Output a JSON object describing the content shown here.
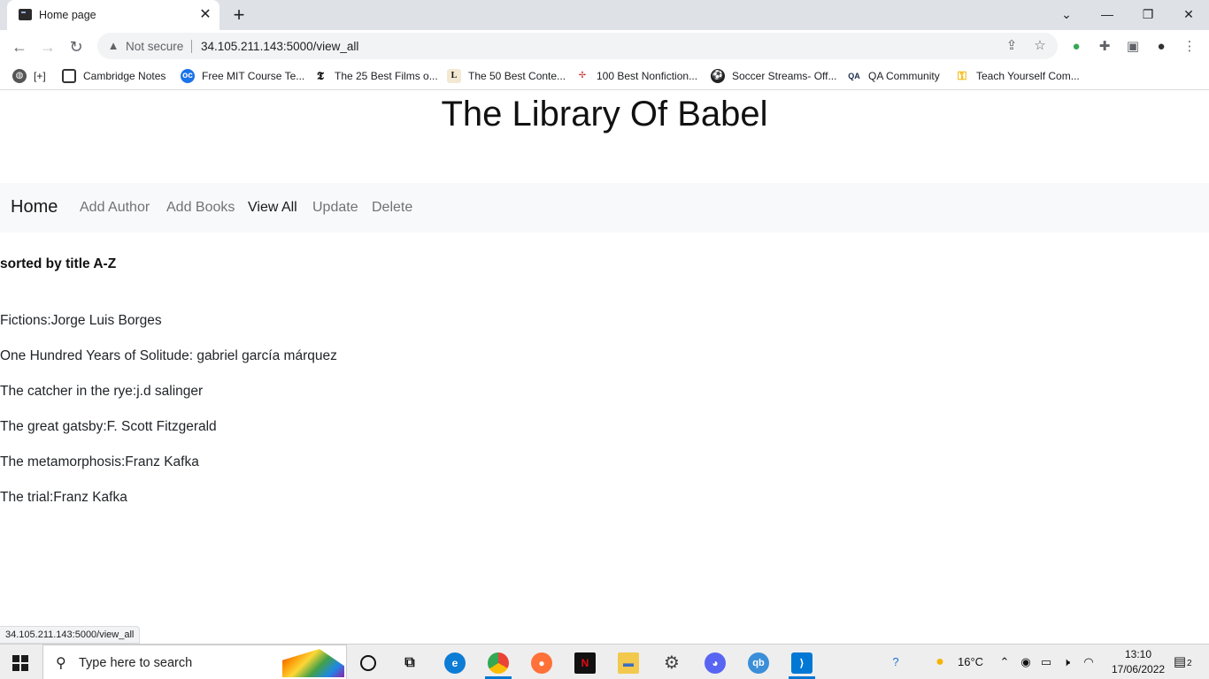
{
  "browser": {
    "tab_title": "Home page",
    "security_label": "Not secure",
    "url": "34.105.211.143:5000/view_all",
    "bookmarks": [
      {
        "label": "[+]",
        "icon": "globe-icon",
        "color": "#555555"
      },
      {
        "label": "Cambridge Notes",
        "icon": "cambridge-icon",
        "color": "#333333"
      },
      {
        "label": "Free MIT Course Te...",
        "icon": "oc-icon",
        "color": "#1a73e8"
      },
      {
        "label": "The 25 Best Films o...",
        "icon": "nyt-icon",
        "color": "#111111"
      },
      {
        "label": "The 50 Best Conte...",
        "icon": "l-icon",
        "color": "#f3e9d2"
      },
      {
        "label": "100 Best Nonfiction...",
        "icon": "bookmark-icon",
        "color": "#c62828"
      },
      {
        "label": "Soccer Streams- Off...",
        "icon": "soccer-icon",
        "color": "#222222"
      },
      {
        "label": "QA Community",
        "icon": "qa-icon",
        "color": "#1a2b4c"
      },
      {
        "label": "Teach Yourself Com...",
        "icon": "key-icon",
        "color": "#f4b400"
      }
    ],
    "status_url": "34.105.211.143:5000/view_all"
  },
  "page": {
    "title": "The Library Of Babel",
    "nav": {
      "brand": "Home",
      "links": [
        "Add Author",
        "Add Books",
        "View All",
        "Update",
        "Delete"
      ]
    },
    "sort_label": "sorted by title A-Z",
    "books": [
      "Fictions:Jorge Luis Borges",
      "One Hundred Years of Solitude: gabriel garcía márquez",
      "The catcher in the rye:j.d salinger",
      "The great gatsby:F. Scott Fitzgerald",
      "The metamorphosis:Franz Kafka",
      "The trial:Franz Kafka"
    ]
  },
  "taskbar": {
    "search_placeholder": "Type here to search",
    "temperature": "16°C",
    "time": "13:10",
    "date": "17/06/2022",
    "notification_count": "2",
    "apps": [
      {
        "name": "cortana-icon",
        "color": "#eeeeef"
      },
      {
        "name": "task-view-icon",
        "color": "#eeeeef"
      },
      {
        "name": "edge-icon",
        "color": "#0c7cd5"
      },
      {
        "name": "chrome-icon",
        "color": "#34a853"
      },
      {
        "name": "firefox-icon",
        "color": "#ff7139"
      },
      {
        "name": "netflix-icon",
        "color": "#111111"
      },
      {
        "name": "file-explorer-icon",
        "color": "#f2c94c"
      },
      {
        "name": "settings-icon",
        "color": "#555555"
      },
      {
        "name": "discord-icon",
        "color": "#5865f2"
      },
      {
        "name": "qbittorrent-icon",
        "color": "#3b8ed8"
      },
      {
        "name": "vscode-icon",
        "color": "#0078d4"
      }
    ]
  }
}
